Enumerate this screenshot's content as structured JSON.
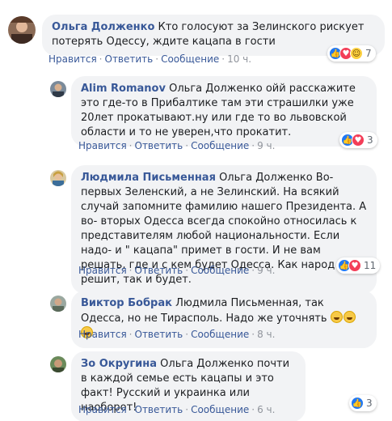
{
  "actions": {
    "like": "Нравится",
    "reply": "Ответить",
    "message": "Сообщение",
    "dot": "·"
  },
  "comments": [
    {
      "author": "Ольга Долженко",
      "mention": "",
      "text": "Кто голосуют за Зелинского рискует потерять Одессу, ждите кацапа в гости",
      "time": "10 ч.",
      "reactions": {
        "icons": [
          "like-icon",
          "love-icon",
          "haha-icon"
        ],
        "count": "7"
      }
    },
    {
      "author": "Alim Romanov",
      "mention": "Ольга Долженко",
      "text": "ойй расскажите это где-то в Прибалтике там эти страшилки уже 20лет прокатывают.ну или где то во львовской области и то не уверен,что прокатит.",
      "time": "9 ч.",
      "reactions": {
        "icons": [
          "like-icon",
          "love-icon"
        ],
        "count": "3"
      }
    },
    {
      "author": "Людмила Письменная",
      "mention": "Ольга Долженко",
      "text": "Во- первых Зеленский, а не Зелинский. На всякий случай запомните фамилию нашего Президента. А во- вторых Одесса всегда спокойно относилась к представителям любой национальности. Если надо- и \" кацапа\" примет в гости. И не вам решать, где и с кем будет Одесса. Как народ решит, так и будет.",
      "time": "9 ч.",
      "reactions": {
        "icons": [
          "like-icon",
          "love-icon"
        ],
        "count": "11"
      }
    },
    {
      "author": "Виктор Бобрак",
      "mention": "Людмила Письменная",
      "text": ", так Одесса, но не Тирасполь. Надо же уточнять",
      "time": "8 ч.",
      "emojis": [
        "grinning-emoji",
        "grinning-emoji",
        "grinning-emoji"
      ]
    },
    {
      "author": "Зо Округина",
      "mention": "Ольга Долженко",
      "text": "почти в каждой семье есть кацапы и это факт! Русский и украинка или наоборот!",
      "time": "6 ч.",
      "reactions": {
        "icons": [
          "like-icon"
        ],
        "count": "3"
      }
    }
  ],
  "colors": {
    "link": "#385898",
    "bubble": "#f2f3f5",
    "meta": "#90949c"
  }
}
